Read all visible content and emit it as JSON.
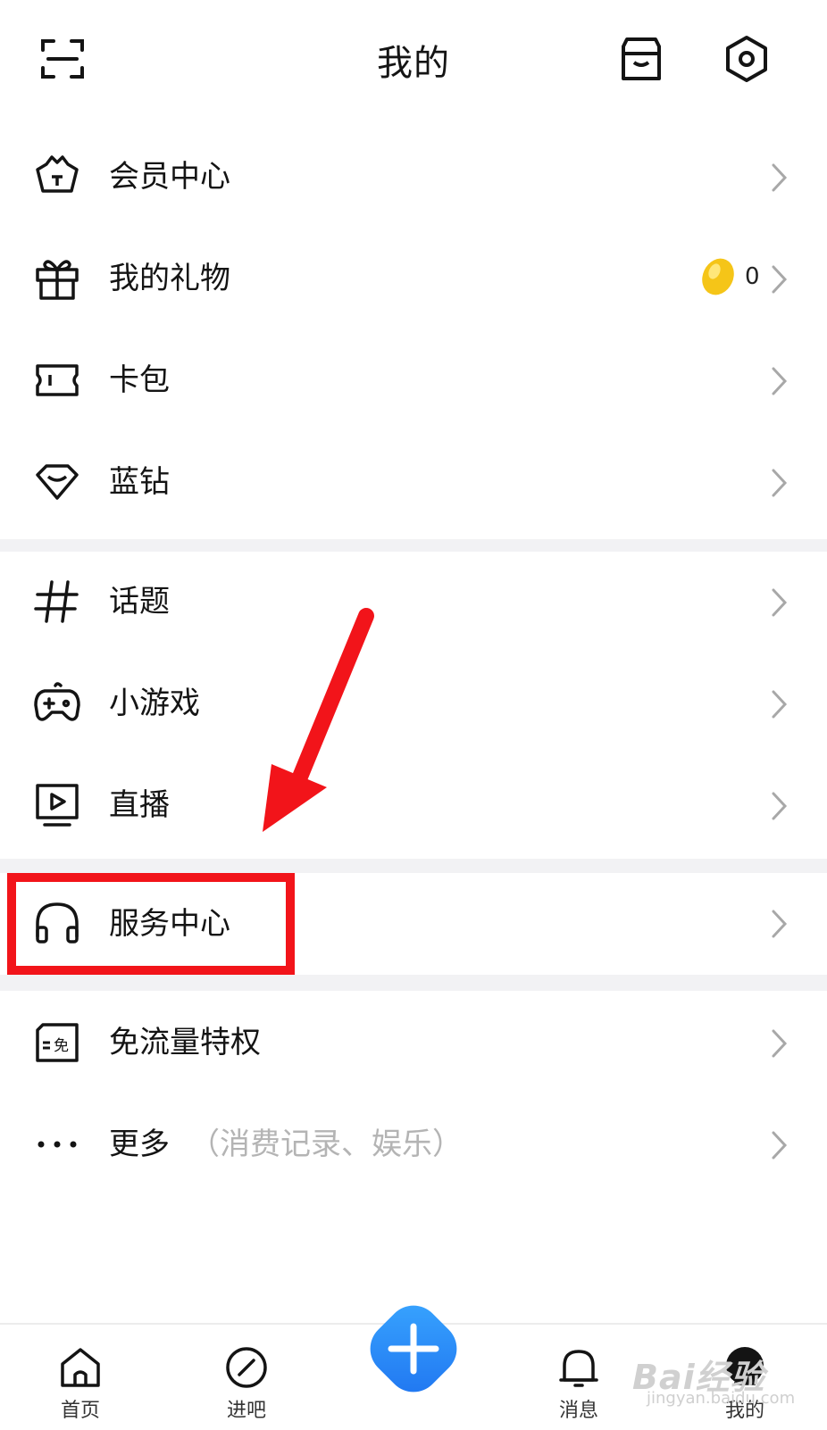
{
  "header": {
    "title": "我的"
  },
  "menu_group1": [
    {
      "label": "会员中心",
      "icon": "crown-icon"
    },
    {
      "label": "我的礼物",
      "icon": "gift-icon",
      "count": "0",
      "extra_icon": "bean-icon"
    },
    {
      "label": "卡包",
      "icon": "ticket-icon"
    },
    {
      "label": "蓝钻",
      "icon": "diamond-icon"
    }
  ],
  "menu_group2": [
    {
      "label": "话题",
      "icon": "hashtag-icon"
    },
    {
      "label": "小游戏",
      "icon": "gamepad-icon"
    },
    {
      "label": "直播",
      "icon": "live-tv-icon"
    }
  ],
  "menu_group3": [
    {
      "label": "服务中心",
      "icon": "headphones-icon"
    }
  ],
  "menu_group4": [
    {
      "label": "免流量特权",
      "icon": "free-data-icon",
      "icon_text": "免"
    },
    {
      "label": "更多",
      "sub": "（消费记录、娱乐）",
      "icon": "more-dots-icon"
    }
  ],
  "tabbar": {
    "tabs": [
      {
        "label": "首页",
        "icon": "home-icon"
      },
      {
        "label": "进吧",
        "icon": "compass-icon"
      },
      {
        "label": "消息",
        "icon": "bell-icon"
      },
      {
        "label": "我的",
        "icon": "profile-icon"
      }
    ]
  },
  "watermark": {
    "brand": "Bai经验",
    "url": "jingyan.baidu.com"
  },
  "colors": {
    "accent": "#2b8cff",
    "highlight": "#f2141a",
    "separator": "#f2f2f4"
  }
}
